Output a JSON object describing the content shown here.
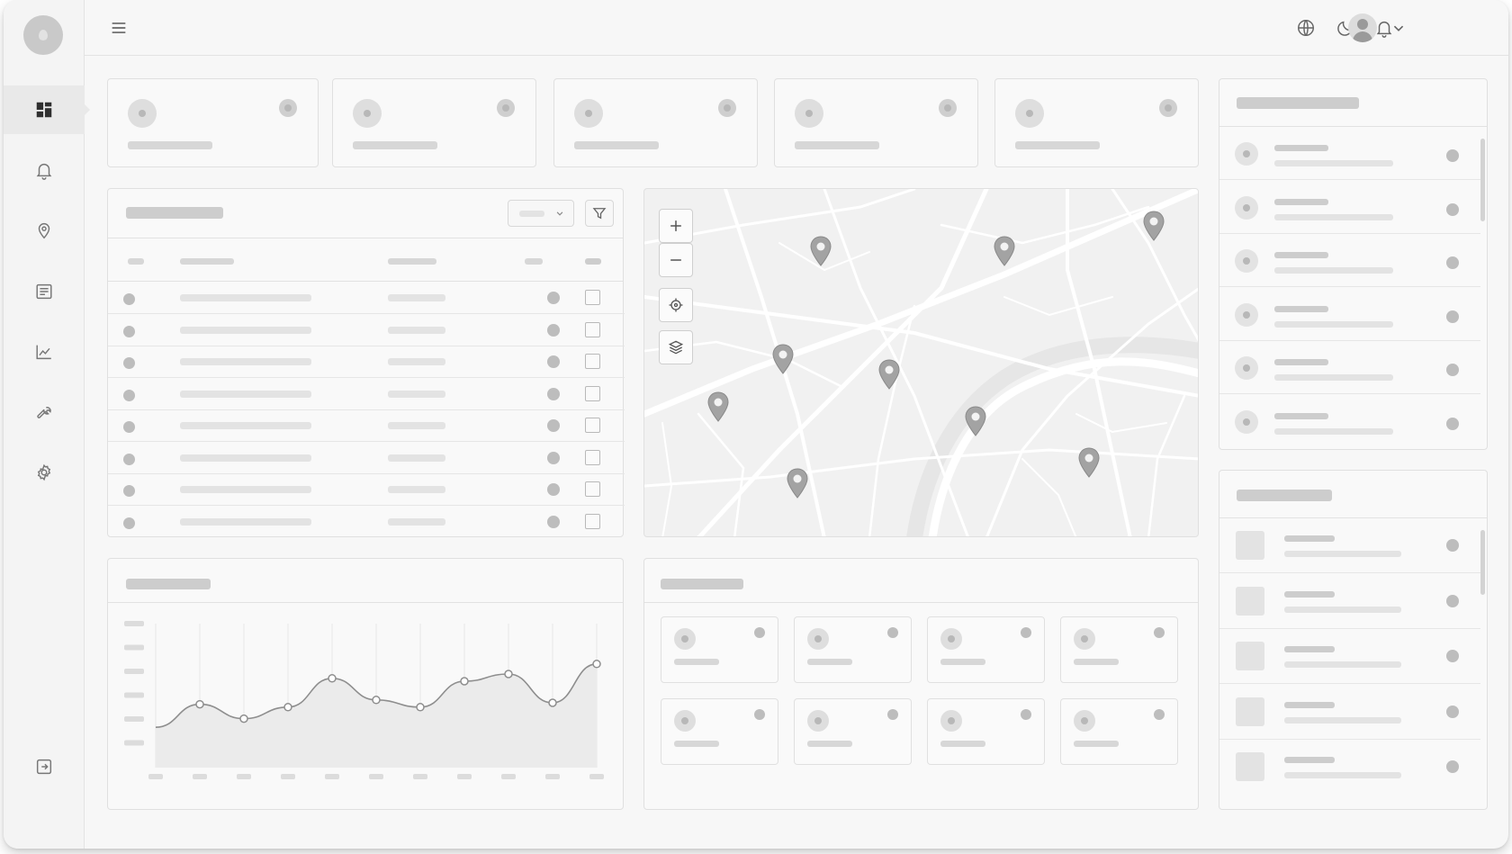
{
  "sidebar": {
    "logo": "logo-icon",
    "items": [
      {
        "name": "dashboard",
        "icon": "dashboard-icon",
        "active": true
      },
      {
        "name": "notifications",
        "icon": "bell-icon",
        "active": false
      },
      {
        "name": "locations",
        "icon": "map-pin-icon",
        "active": false
      },
      {
        "name": "reports",
        "icon": "document-list-icon",
        "active": false
      },
      {
        "name": "analytics",
        "icon": "line-chart-icon",
        "active": false
      },
      {
        "name": "tools",
        "icon": "wrench-icon",
        "active": false
      },
      {
        "name": "settings",
        "icon": "gear-icon",
        "active": false
      }
    ],
    "footer_icon": "logout-icon"
  },
  "topbar": {
    "menu_icon": "hamburger-menu-icon",
    "right_icons": [
      "globe-icon",
      "moon-icon",
      "bell-icon"
    ],
    "avatar": "avatar-icon",
    "chevron": "chevron-down-icon"
  },
  "stat_cards_count": 5,
  "table": {
    "row_count": 8,
    "filter_icon": "filter-icon",
    "dropdown_icon": "chevron-down-icon"
  },
  "map": {
    "controls": [
      "zoom-in-icon",
      "zoom-out-icon",
      "locate-icon",
      "layers-icon"
    ],
    "pin_count": 9
  },
  "chart_data": {
    "type": "area",
    "title": "",
    "xlabel": "",
    "ylabel": "",
    "x": [
      0,
      1,
      2,
      3,
      4,
      5,
      6,
      7,
      8,
      9,
      10
    ],
    "series": [
      {
        "values": [
          0.28,
          0.44,
          0.34,
          0.42,
          0.62,
          0.47,
          0.42,
          0.6,
          0.65,
          0.45,
          0.72
        ]
      }
    ],
    "ylim": [
      0,
      1
    ],
    "grid": true,
    "legend": "none"
  },
  "mini_cards_count": 8,
  "right_list_top": {
    "item_count": 6
  },
  "right_list_bottom": {
    "item_count": 5
  },
  "colors": {
    "background": "#f7f7f7",
    "card": "#f9f9f9",
    "border": "#e0e0e0",
    "placeholder": "#d7d7d7",
    "icon": "#7a7a7a",
    "pin": "#a3a3a3"
  }
}
